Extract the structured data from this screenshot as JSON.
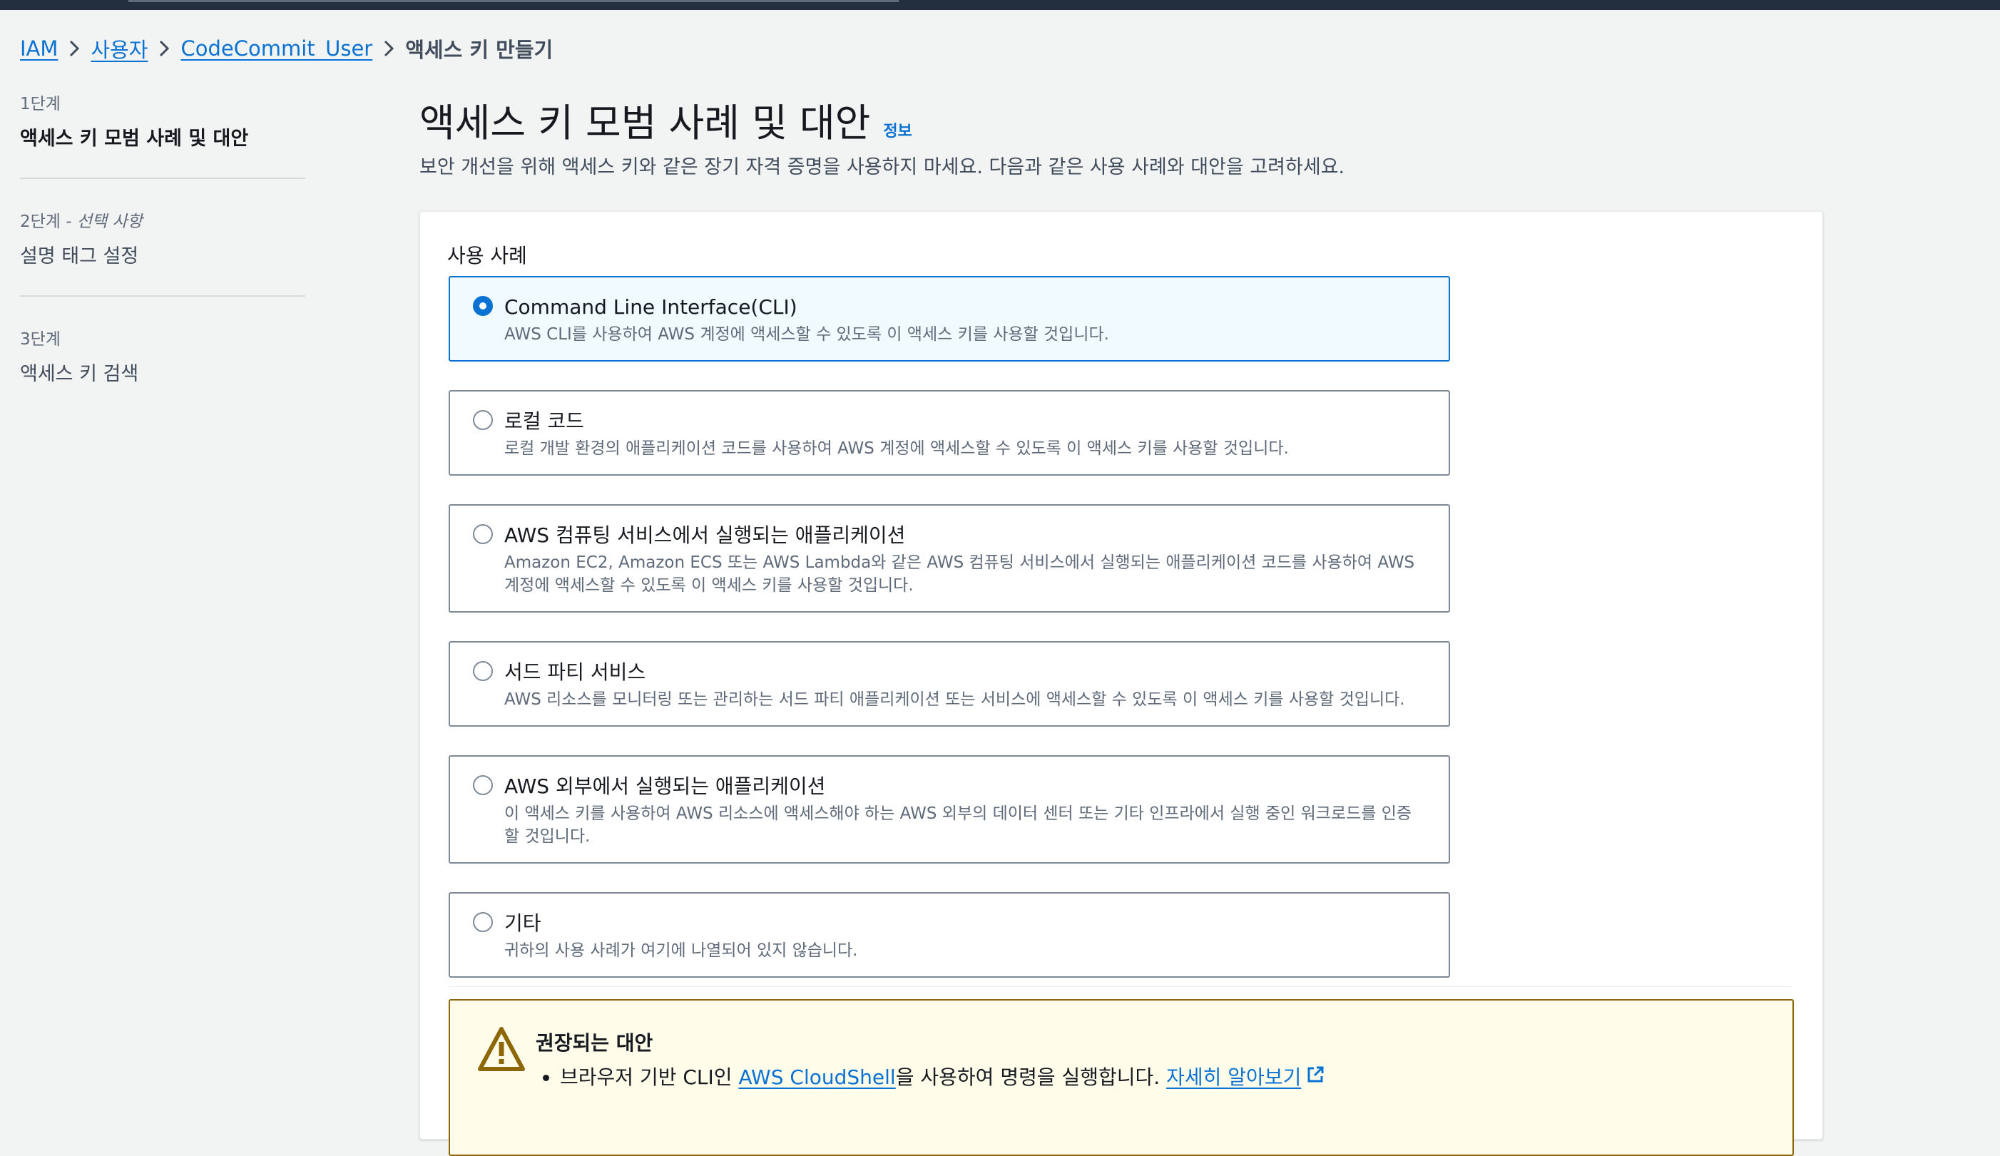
{
  "breadcrumb": {
    "items": [
      "IAM",
      "사용자",
      "CodeCommit_User"
    ],
    "current": "액세스 키 만들기"
  },
  "steps": [
    {
      "num": "1단계",
      "optional": "",
      "title": "액세스 키 모범 사례 및 대안",
      "active": true
    },
    {
      "num": "2단계 - ",
      "optional": "선택 사항",
      "title": "설명 태그 설정",
      "active": false
    },
    {
      "num": "3단계",
      "optional": "",
      "title": "액세스 키 검색",
      "active": false
    }
  ],
  "page": {
    "title": "액세스 키 모범 사례 및 대안",
    "info": "정보",
    "description": "보안 개선을 위해 액세스 키와 같은 장기 자격 증명을 사용하지 마세요. 다음과 같은 사용 사례와 대안을 고려하세요."
  },
  "use_cases": {
    "label": "사용 사례",
    "selected_index": 0,
    "options": [
      {
        "title": "Command Line Interface(CLI)",
        "desc": "AWS CLI를 사용하여 AWS 계정에 액세스할 수 있도록 이 액세스 키를 사용할 것입니다."
      },
      {
        "title": "로컬 코드",
        "desc": "로컬 개발 환경의 애플리케이션 코드를 사용하여 AWS 계정에 액세스할 수 있도록 이 액세스 키를 사용할 것입니다."
      },
      {
        "title": "AWS 컴퓨팅 서비스에서 실행되는 애플리케이션",
        "desc": "Amazon EC2, Amazon ECS 또는 AWS Lambda와 같은 AWS 컴퓨팅 서비스에서 실행되는 애플리케이션 코드를 사용하여 AWS 계정에 액세스할 수 있도록 이 액세스 키를 사용할 것입니다."
      },
      {
        "title": "서드 파티 서비스",
        "desc": "AWS 리소스를 모니터링 또는 관리하는 서드 파티 애플리케이션 또는 서비스에 액세스할 수 있도록 이 액세스 키를 사용할 것입니다."
      },
      {
        "title": "AWS 외부에서 실행되는 애플리케이션",
        "desc": "이 액세스 키를 사용하여 AWS 리소스에 액세스해야 하는 AWS 외부의 데이터 센터 또는 기타 인프라에서 실행 중인 워크로드를 인증할 것입니다."
      },
      {
        "title": "기타",
        "desc": "귀하의 사용 사례가 여기에 나열되어 있지 않습니다."
      }
    ]
  },
  "alert": {
    "title": "권장되는 대안",
    "item1": {
      "prefix": "브라우저 기반 CLI인 ",
      "link": "AWS CloudShell",
      "suffix": "을 사용하여 명령을 실행합니다. ",
      "learn_more": "자세히 알아보기"
    }
  },
  "colors": {
    "link": "#0972d3",
    "selected_bg": "#f1faff",
    "warning_bg": "#fffce9",
    "warning_border": "#8d6605",
    "topbar": "#232f3e"
  }
}
